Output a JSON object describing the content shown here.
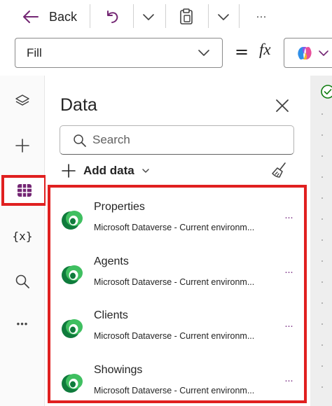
{
  "toolbar": {
    "back_label": "Back",
    "more_label": "···"
  },
  "formula_bar": {
    "property_value": "Fill",
    "equals": "=",
    "fx": "fx"
  },
  "rail": {
    "items": [
      "layers-icon",
      "plus-icon",
      "data-grid-icon",
      "variables-icon",
      "search-icon",
      "more-icon"
    ],
    "active": "data-grid-icon",
    "variables_glyph": "{x}",
    "more_glyph": "•••"
  },
  "panel": {
    "title": "Data",
    "search_placeholder": "Search",
    "add_data_label": "Add data",
    "data_sources": [
      {
        "name": "Properties",
        "description": "Microsoft Dataverse - Current environm..."
      },
      {
        "name": "Agents",
        "description": "Microsoft Dataverse - Current environm..."
      },
      {
        "name": "Clients",
        "description": "Microsoft Dataverse - Current environm..."
      },
      {
        "name": "Showings",
        "description": "Microsoft Dataverse - Current environm..."
      }
    ],
    "item_more": "···"
  },
  "colors": {
    "accent": "#742774",
    "highlight": "#e02020",
    "dataverse_green": "#0f7b3c",
    "status_green": "#107c10"
  }
}
